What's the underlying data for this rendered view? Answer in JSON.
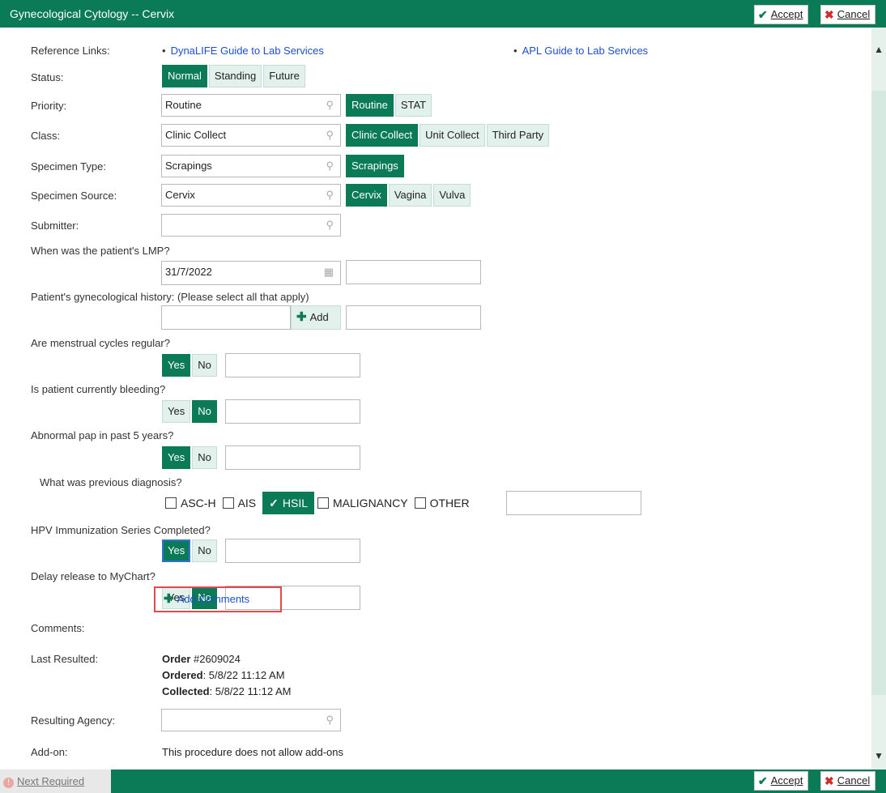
{
  "window": {
    "title": "Gynecological Cytology -- Cervix",
    "accept_label": "Accept",
    "cancel_label": "Cancel"
  },
  "reference_links": {
    "label": "Reference Links:",
    "link1": "DynaLIFE Guide to Lab Services",
    "link2": "APL Guide to Lab Services",
    "bullet": "•"
  },
  "status": {
    "label": "Status:",
    "options": [
      "Normal",
      "Standing",
      "Future"
    ],
    "selected": "Normal"
  },
  "priority": {
    "label": "Priority:",
    "value": "Routine",
    "options": [
      "Routine",
      "STAT"
    ],
    "selected": "Routine"
  },
  "class": {
    "label": "Class:",
    "value": "Clinic Collect",
    "options": [
      "Clinic Collect",
      "Unit Collect",
      "Third Party"
    ],
    "selected": "Clinic Collect"
  },
  "specimen_type": {
    "label": "Specimen Type:",
    "value": "Scrapings",
    "options": [
      "Scrapings"
    ],
    "selected": "Scrapings"
  },
  "specimen_source": {
    "label": "Specimen Source:",
    "value": "Cervix",
    "options": [
      "Cervix",
      "Vagina",
      "Vulva"
    ],
    "selected": "Cervix"
  },
  "submitter": {
    "label": "Submitter:",
    "value": ""
  },
  "lmp": {
    "question": "When was the patient's LMP?",
    "value": "31/7/2022"
  },
  "gyn_history": {
    "question": "Patient's gynecological history: (Please select all that apply)",
    "add_label": "Add"
  },
  "menstrual": {
    "question": "Are menstrual cycles regular?",
    "options": [
      "Yes",
      "No"
    ],
    "selected": "Yes"
  },
  "bleeding": {
    "question": "Is patient currently bleeding?",
    "options": [
      "Yes",
      "No"
    ],
    "selected": "No"
  },
  "abnormal_pap": {
    "question": "Abnormal pap in past 5 years?",
    "options": [
      "Yes",
      "No"
    ],
    "selected": "Yes"
  },
  "previous_diagnosis": {
    "question": "What was previous diagnosis?",
    "options": [
      "ASC-H",
      "AIS",
      "HSIL",
      "MALIGNANCY",
      "OTHER"
    ],
    "selected": "HSIL"
  },
  "hpv": {
    "question": "HPV Immunization Series Completed?",
    "options": [
      "Yes",
      "No"
    ],
    "selected": "Yes"
  },
  "delay_release": {
    "question": "Delay release to MyChart?",
    "options": [
      "Yes",
      "No"
    ],
    "selected": "No"
  },
  "comments": {
    "label": "Comments:",
    "add_label": "Add Comments"
  },
  "last_resulted": {
    "label": "Last Resulted:",
    "order_label": "Order",
    "order_value": " #2609024",
    "ordered_label": "Ordered",
    "ordered_value": ": 5/8/22 11:12 AM",
    "collected_label": "Collected",
    "collected_value": ": 5/8/22 11:12 AM"
  },
  "resulting_agency": {
    "label": "Resulting Agency:",
    "value": ""
  },
  "addon": {
    "label": "Add-on:",
    "text": "This procedure does not allow add-ons"
  },
  "footer": {
    "next_required": "Next Required"
  },
  "colors": {
    "accent": "#0b7a56",
    "link": "#1e50c8",
    "highlight_box": "#e24a4a"
  },
  "icons": [
    "checkmark-icon",
    "x-icon",
    "search-icon",
    "calendar-icon",
    "plus-icon",
    "alert-icon",
    "chevron-up-icon",
    "chevron-down-icon"
  ]
}
